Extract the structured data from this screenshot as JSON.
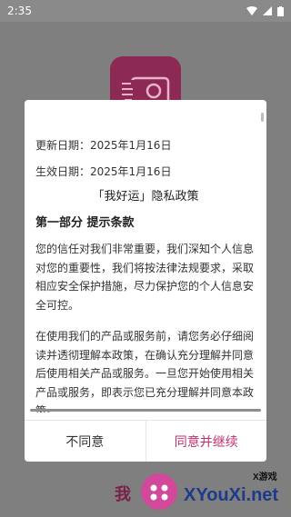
{
  "status_bar": {
    "time": "2:35"
  },
  "dialog": {
    "update_date": "更新日期：2025年1月16日",
    "effective_date": "生效日期：2025年1月16日",
    "title": "「我好运」隐私政策",
    "section_title": "第一部分 提示条款",
    "paragraph_1": "您的信任对我们非常重要，我们深知个人信息对您的重要性，我们将按法律法规要求，采取相应安全保护措施，尽力保护您的个人信息安全可控。",
    "paragraph_2": "在使用我们的产品或服务前，请您务必仔细阅读并透彻理解本政策，在确认充分理解并同意后使用相关产品或服务。一旦您开始使用相关产品或服务，即表示您已充分理解并同意本政策。",
    "disagree_label": "不同意",
    "agree_label": "同意并继续"
  },
  "background": {
    "bottom_text": "我"
  },
  "watermark": {
    "brand": "XYouXi.net",
    "sub": "X游戏"
  },
  "colors": {
    "accent": "#c0306f",
    "logo_bg": "#8c2a55"
  }
}
